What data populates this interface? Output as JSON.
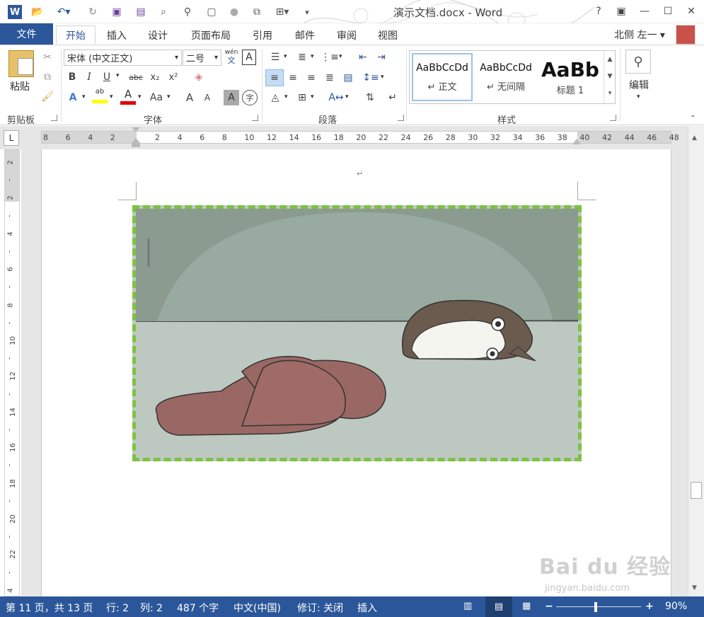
{
  "title": {
    "doc_title": "演示文档.docx - Word"
  },
  "window": {
    "help": "?",
    "restore": "▣",
    "minimize": "—",
    "maximize": "☐",
    "close": "✕"
  },
  "tabs": [
    {
      "label": "文件"
    },
    {
      "label": "开始"
    },
    {
      "label": "插入"
    },
    {
      "label": "设计"
    },
    {
      "label": "页面布局"
    },
    {
      "label": "引用"
    },
    {
      "label": "邮件"
    },
    {
      "label": "审阅"
    },
    {
      "label": "视图"
    }
  ],
  "user": {
    "name": "北侧 左一 ▾"
  },
  "clipboard": {
    "paste_label": "粘贴",
    "group_label": "剪贴板"
  },
  "font": {
    "name": "宋体 (中文正文)",
    "size": "二号",
    "group_label": "字体",
    "wen_top": "wén",
    "wen_bottom": "文",
    "a_box": "A",
    "bold": "B",
    "italic": "I",
    "underline": "U",
    "strike": "abc",
    "sub": "x₂",
    "sup": "x²",
    "grow": "A",
    "shrink": "A",
    "case": "Aa",
    "char_shade": "A",
    "enclose": "字",
    "highlight_label": "ab",
    "color_label": "A"
  },
  "paragraph": {
    "group_label": "段落"
  },
  "styles": {
    "group_label": "样式",
    "items": [
      {
        "preview": "AaBbCcDd",
        "name": "↵ 正文"
      },
      {
        "preview": "AaBbCcDd",
        "name": "↵ 无间隔"
      },
      {
        "preview": "AaBb",
        "name": "标题 1"
      }
    ]
  },
  "editing": {
    "label": "编辑"
  },
  "ruler": {
    "corner": "L",
    "h_ticks": [
      "8",
      "6",
      "4",
      "2",
      "",
      "2",
      "4",
      "6",
      "8",
      "10",
      "12",
      "14",
      "16",
      "18",
      "20",
      "22",
      "24",
      "26",
      "28",
      "30",
      "32",
      "34",
      "36",
      "38",
      "40",
      "42",
      "44",
      "46",
      "48"
    ],
    "v_ticks": [
      "2",
      "",
      "2",
      "",
      "4",
      "",
      "6",
      "",
      "8",
      "",
      "10",
      "",
      "12",
      "",
      "14",
      "",
      "16",
      "",
      "18",
      "",
      "20",
      "",
      "22",
      "",
      "4"
    ]
  },
  "document": {
    "para_mark": "↵"
  },
  "status": {
    "page": "第 11 页，共 13 页",
    "row": "行: 2",
    "col": "列: 2",
    "chars": "487 个字",
    "lang": "中文(中国)",
    "track": "修订: 关闭",
    "mode": "插入",
    "zoom": "90%"
  },
  "watermark": {
    "brand": "Bai du 经验",
    "url": "jingyan.baidu.com"
  },
  "colors": {
    "accent": "#2b579a",
    "image_border": "#7dc242"
  }
}
